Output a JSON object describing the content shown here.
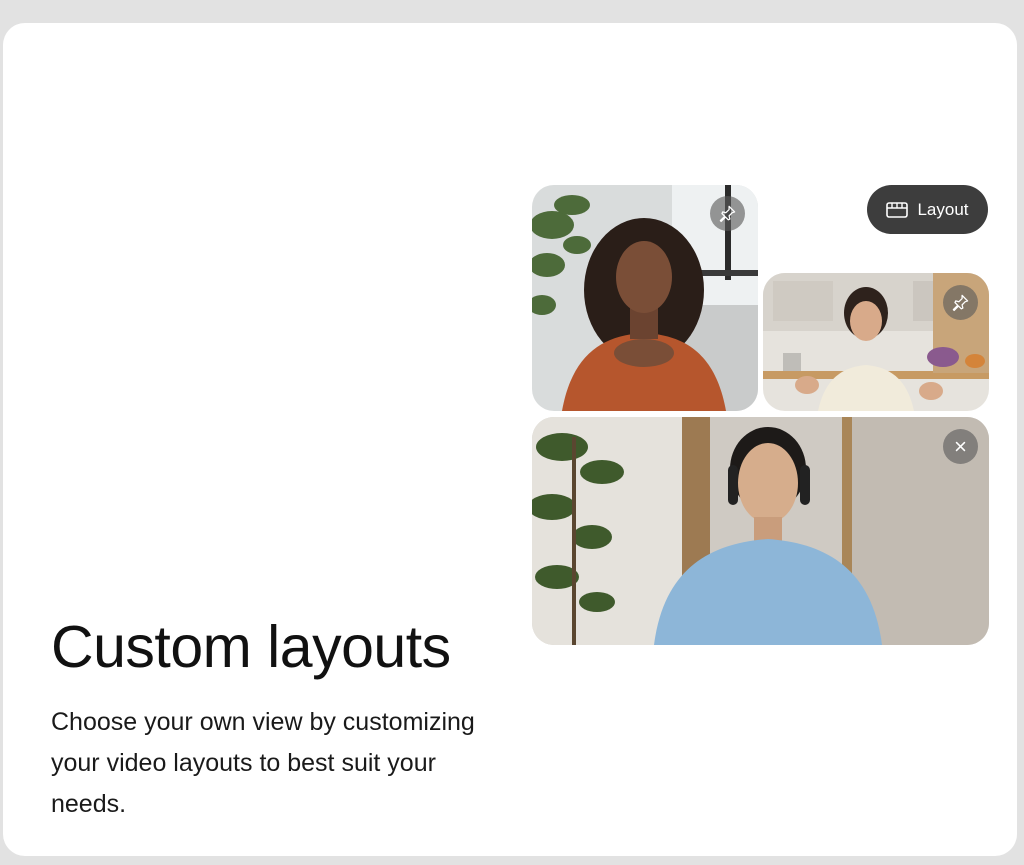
{
  "feature": {
    "title": "Custom layouts",
    "description": "Choose your own view by customizing your video layouts to best suit your needs."
  },
  "controls": {
    "layout_label": "Layout",
    "layout_icon": "layout-icon"
  },
  "participants": [
    {
      "tile": "top-left",
      "action_icon": "pin-icon",
      "description": "woman in rust shirt"
    },
    {
      "tile": "top-right",
      "action_icon": "pin-icon",
      "description": "woman in cream blouse"
    },
    {
      "tile": "bottom-wide",
      "action_icon": "close-icon",
      "description": "man with headphones"
    }
  ],
  "colors": {
    "background": "#e2e2e2",
    "card": "#ffffff",
    "button": "#3d3d3d",
    "overlay_button": "#5a5a5a"
  }
}
